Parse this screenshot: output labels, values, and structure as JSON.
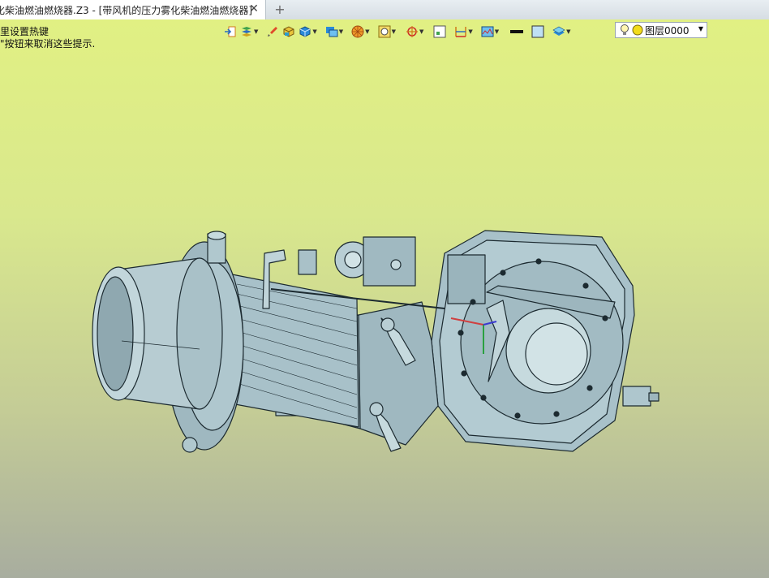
{
  "tab": {
    "title": "化柴油燃油燃烧器.Z3 - [带风机的压力雾化柴油燃油燃烧器]",
    "close_icon": "close-icon",
    "new_tab_icon": "plus-icon"
  },
  "hints": [
    "里设置热键",
    "\"按钮来取消这些提示."
  ],
  "toolbar": {
    "buttons": [
      {
        "name": "exit-sketch-icon",
        "dropdown": false
      },
      {
        "name": "layer-style-icon",
        "dropdown": true
      },
      {
        "name": "brush-icon",
        "dropdown": false
      },
      {
        "name": "solid-box-icon",
        "dropdown": false
      },
      {
        "name": "cube-view-icon",
        "dropdown": true
      },
      {
        "name": "shading-mode-icon",
        "dropdown": true
      },
      {
        "name": "render-color-icon",
        "dropdown": true
      },
      {
        "name": "zoom-window-icon",
        "dropdown": true
      },
      {
        "name": "snap-target-icon",
        "dropdown": true
      },
      {
        "name": "fit-view-icon",
        "dropdown": false
      },
      {
        "name": "dimension-icon",
        "dropdown": true
      },
      {
        "name": "display-settings-icon",
        "dropdown": true
      },
      {
        "name": "line-color-icon",
        "dropdown": false
      },
      {
        "name": "fill-color-icon",
        "dropdown": false
      },
      {
        "name": "layer-stack-icon",
        "dropdown": true
      }
    ]
  },
  "layer_selector": {
    "icons": [
      "bulb-icon",
      "layer-color-icon"
    ],
    "value": "图层0000"
  },
  "colors": {
    "bg_top": "#e1f083",
    "bg_bottom": "#a8ad9f",
    "model_fill": "#a9c2ca",
    "model_edge": "#1c2a30"
  }
}
